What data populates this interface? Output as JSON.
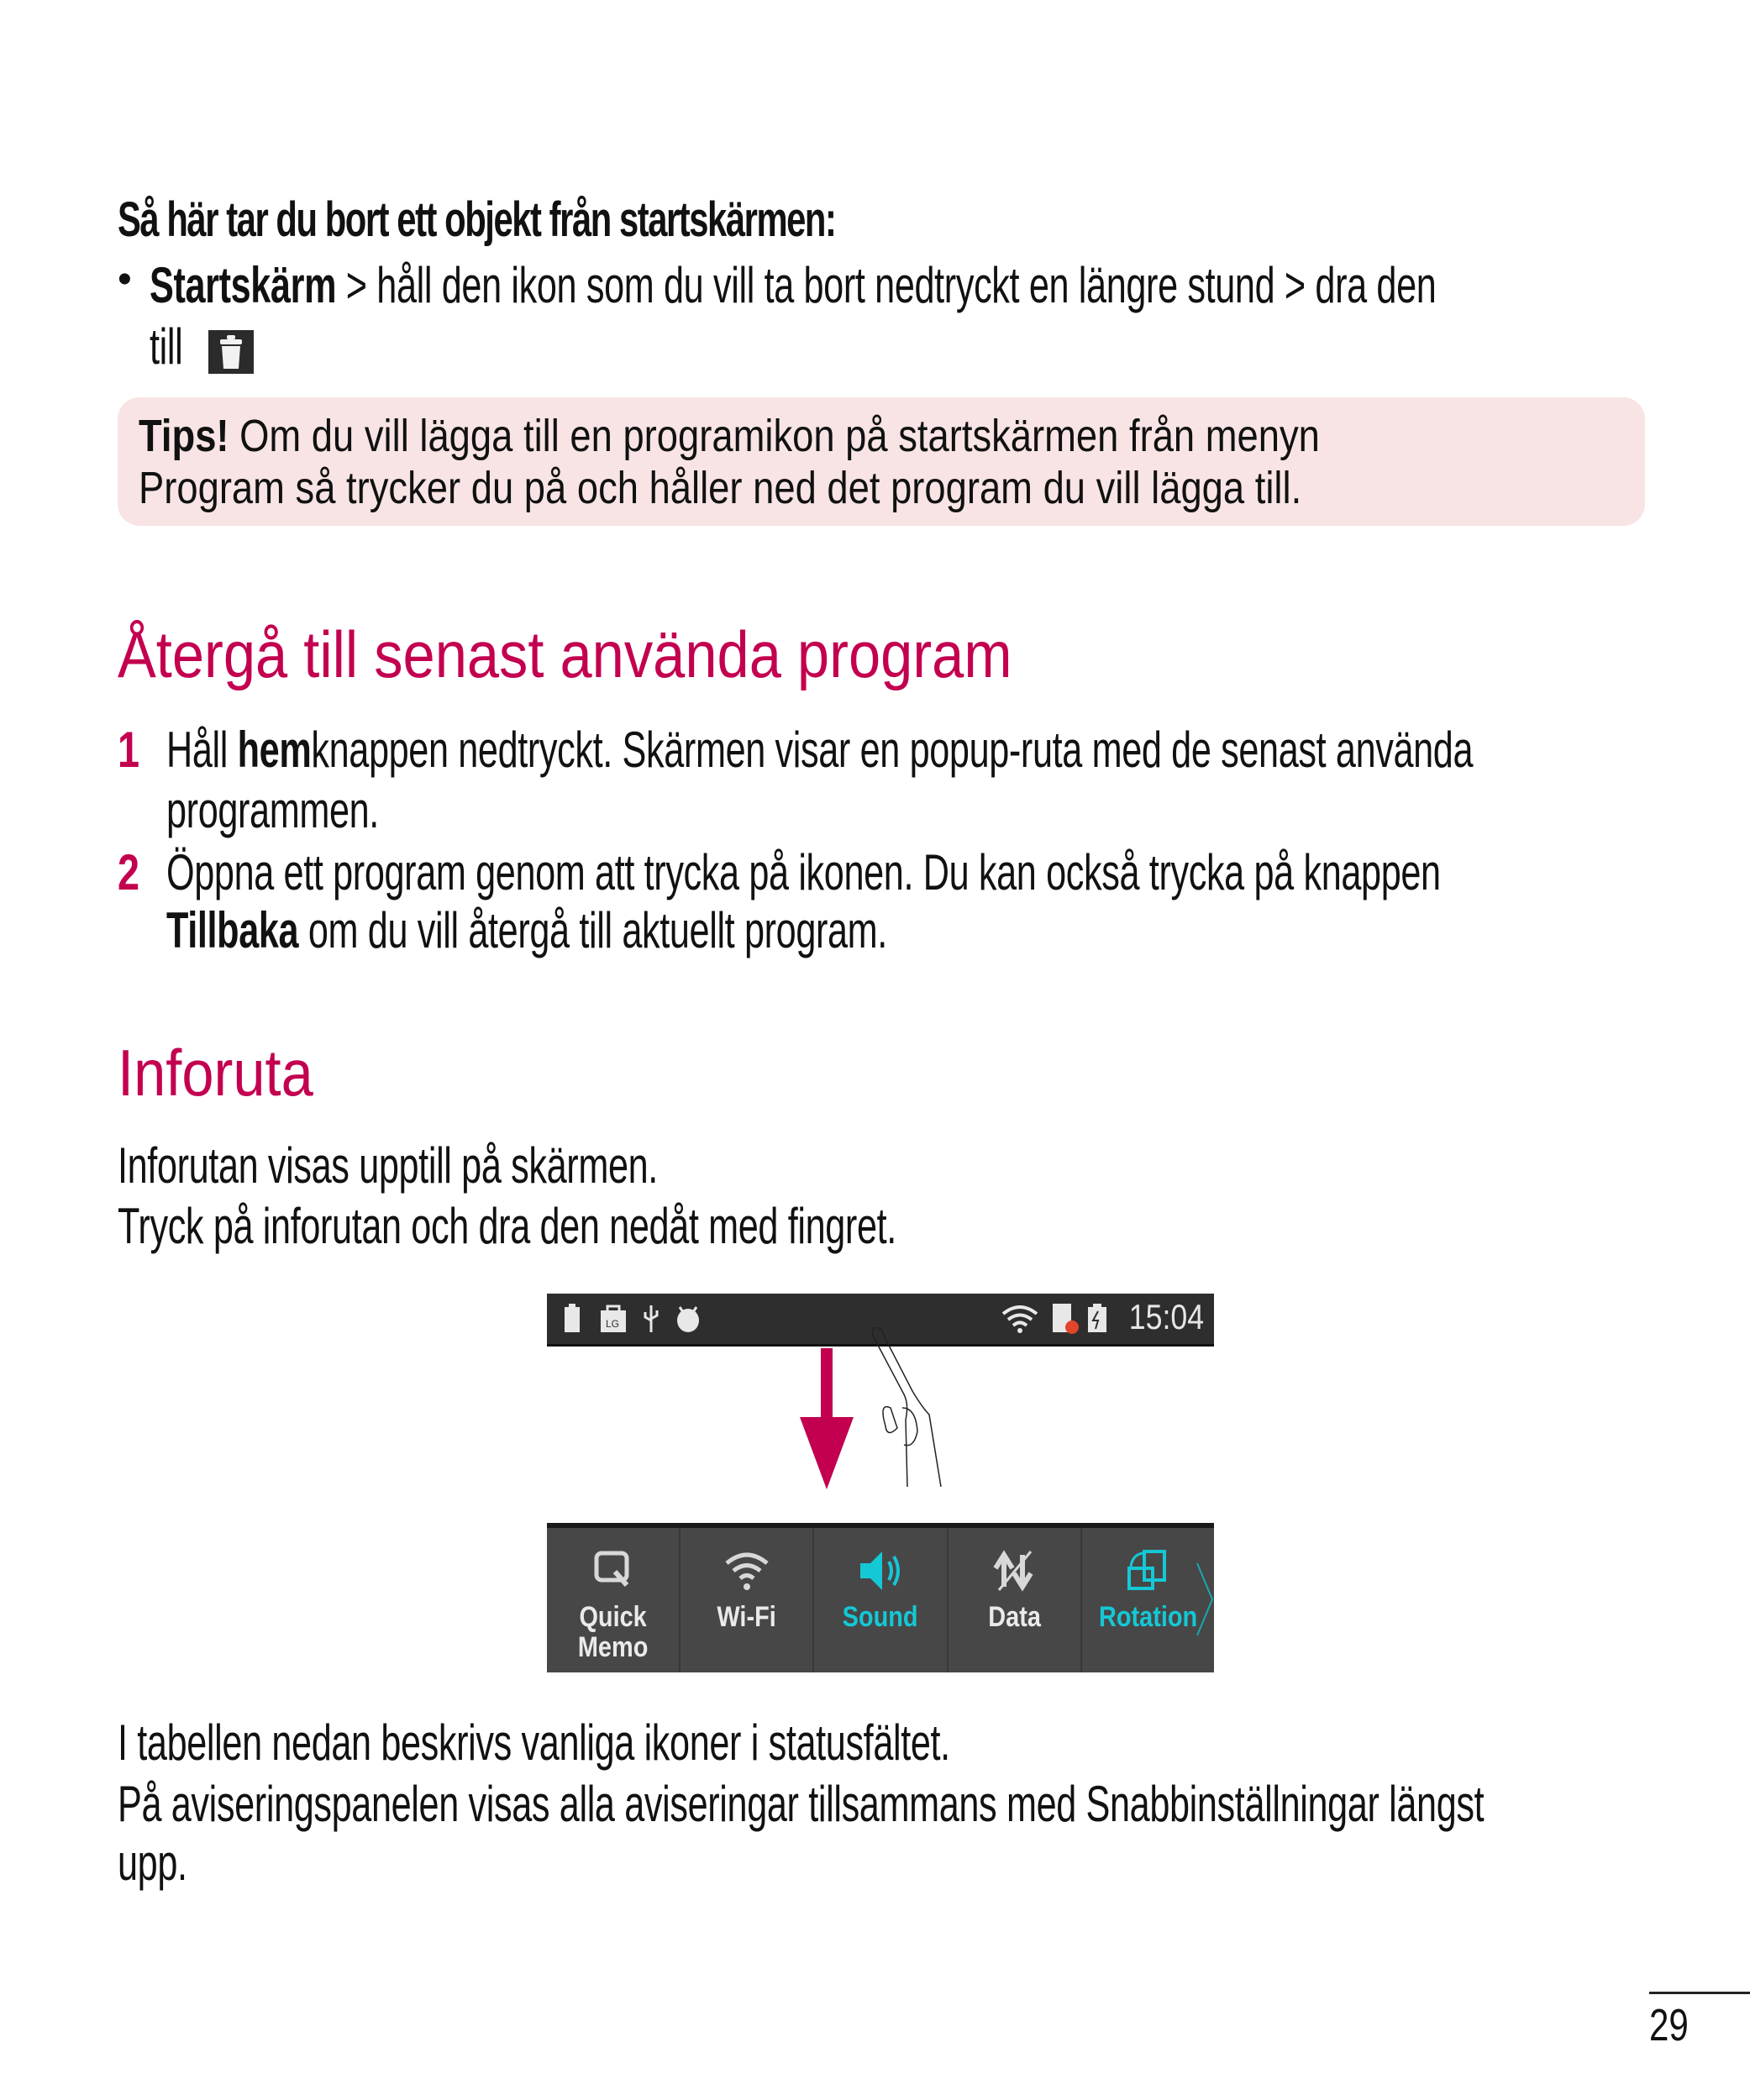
{
  "remove_section": {
    "heading": "Så här tar du bort ett objekt från startskärmen:",
    "bullet_symbol": "•",
    "bullet_bold": "Startskärm",
    "bullet_text": " > håll den ikon som du vill ta bort nedtryckt en längre stund > dra den",
    "bullet_text_2": "till",
    "trash_icon": "trash-icon"
  },
  "tips": {
    "label": "Tips!",
    "line1": " Om du vill lägga till en programikon på startskärmen från menyn",
    "line2": "Program så trycker du på och håller ned det program du vill lägga till.",
    "background": "#f8e4e4"
  },
  "recent_section": {
    "title": "Återgå till senast använda program",
    "steps": [
      {
        "num": "1",
        "pre": "Håll ",
        "bold": "hem",
        "post": "knappen nedtryckt. Skärmen visar en popup-ruta med de senast använda",
        "line2": "programmen."
      },
      {
        "num": "2",
        "pre": "Öppna ett program genom att trycka på ikonen. Du kan också trycka på knappen",
        "bold": "Tillbaka",
        "post": " om du vill återgå till aktuellt program."
      }
    ]
  },
  "info_section": {
    "title": "Inforuta",
    "para1": "Inforutan visas upptill på skärmen.",
    "para2": "Tryck på inforutan och dra den nedåt med fingret."
  },
  "illustration": {
    "status_bar": {
      "left_icons": [
        "battery-icon",
        "lg-bag-icon",
        "usb-icon",
        "android-debug-icon"
      ],
      "right_icons": [
        "wifi-icon",
        "sim-error-icon",
        "battery-charging-icon"
      ],
      "clock": "15:04"
    },
    "quick_settings": [
      {
        "label": "Quick\nMemo",
        "icon": "quick-memo-icon",
        "active": false
      },
      {
        "label": "Wi-Fi",
        "icon": "wifi-icon",
        "active": false
      },
      {
        "label": "Sound",
        "icon": "sound-icon",
        "active": true
      },
      {
        "label": "Data",
        "icon": "data-icon",
        "active": false
      },
      {
        "label": "Rotation",
        "icon": "rotation-icon",
        "active": true
      }
    ],
    "arrow_color": "#c3004f",
    "active_color": "#14c8d6"
  },
  "footer_text": {
    "para1": "I tabellen nedan beskrivs vanliga ikoner i statusfältet.",
    "para2_line1": "På aviseringspanelen visas alla aviseringar tillsammans med Snabbinställningar längst",
    "para2_line2": "upp."
  },
  "page_number": "29",
  "colors": {
    "accent": "#c3004f"
  }
}
